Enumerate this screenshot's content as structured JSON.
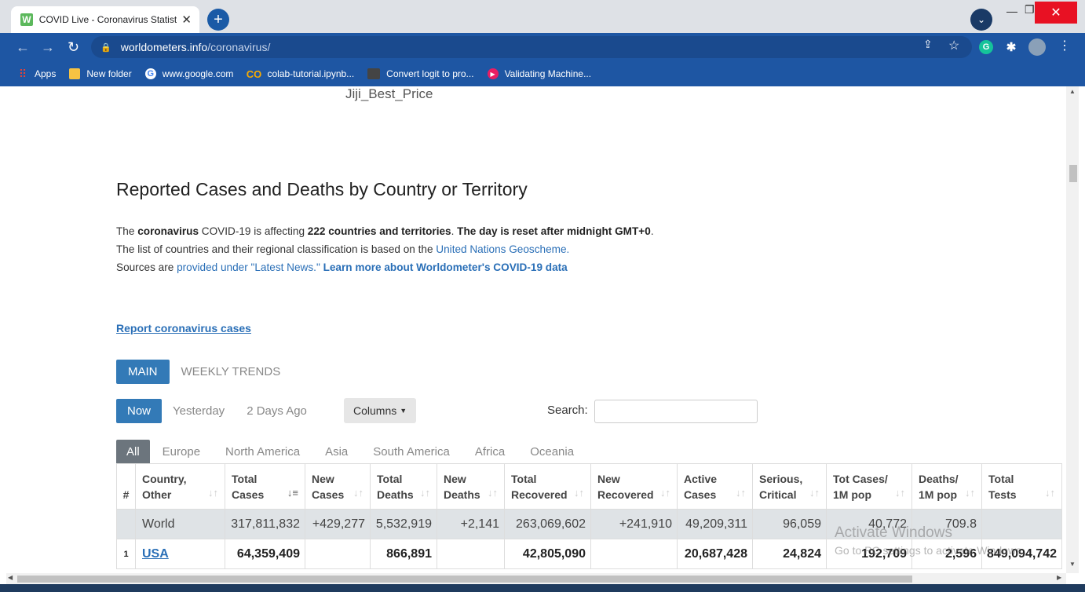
{
  "browser": {
    "tab_title": "COVID Live - Coronavirus Statisti",
    "favicon_letter": "W",
    "url_host": "worldometers.info",
    "url_path": "/coronavirus/",
    "bookmarks": [
      {
        "label": "Apps",
        "icon": "apps-grid-icon"
      },
      {
        "label": "New folder",
        "icon": "folder-icon"
      },
      {
        "label": "www.google.com",
        "icon": "google-icon"
      },
      {
        "label": "colab-tutorial.ipynb...",
        "icon": "colab-icon"
      },
      {
        "label": "Convert logit to pro...",
        "icon": "page-thumbnail-icon"
      },
      {
        "label": "Validating Machine...",
        "icon": "play-icon"
      }
    ]
  },
  "page": {
    "ad_label": "Jiji_Best_Price",
    "heading": "Reported Cases and Deaths by Country or Territory",
    "intro": {
      "p1": "The ",
      "b1": "coronavirus",
      "p2": " COVID-19 is affecting ",
      "b2": "222 countries and territories",
      "p3": ". ",
      "b3": "The day is reset after midnight GMT+0",
      "p4": ". The list of countries and their regional classification is based on the ",
      "link1": "United Nations Geoscheme.",
      "p5": " Sources are ",
      "link2": "provided under \"Latest News.\"",
      "p6": " ",
      "link3": "Learn more about Worldometer's COVID-19 data"
    },
    "report_link": "Report coronavirus cases",
    "view_tabs": [
      "MAIN",
      "WEEKLY TRENDS"
    ],
    "day_tabs": [
      "Now",
      "Yesterday",
      "2 Days Ago"
    ],
    "columns_button": "Columns",
    "search_label": "Search:",
    "search_value": "",
    "regions": [
      "All",
      "Europe",
      "North America",
      "Asia",
      "South America",
      "Africa",
      "Oceania"
    ]
  },
  "table": {
    "headers": [
      "#",
      "Country, Other",
      "Total Cases",
      "New Cases",
      "Total Deaths",
      "New Deaths",
      "Total Recovered",
      "New Recovered",
      "Active Cases",
      "Serious, Critical",
      "Tot Cases/ 1M pop",
      "Deaths/ 1M pop",
      "Total Tests"
    ],
    "header_lines": [
      [
        "#",
        ""
      ],
      [
        "Country,",
        "Other"
      ],
      [
        "Total",
        "Cases"
      ],
      [
        "New",
        "Cases"
      ],
      [
        "Total",
        "Deaths"
      ],
      [
        "New",
        "Deaths"
      ],
      [
        "Total",
        "Recovered"
      ],
      [
        "New",
        "Recovered"
      ],
      [
        "Active",
        "Cases"
      ],
      [
        "Serious,",
        "Critical"
      ],
      [
        "Tot Cases/",
        "1M pop"
      ],
      [
        "Deaths/",
        "1M pop"
      ],
      [
        "Total",
        "Tests"
      ]
    ],
    "world": [
      "",
      "World",
      "317,811,832",
      "+429,277",
      "5,532,919",
      "+2,141",
      "263,069,602",
      "+241,910",
      "49,209,311",
      "96,059",
      "40,772",
      "709.8",
      ""
    ],
    "rows": [
      [
        "1",
        "USA",
        "64,359,409",
        "",
        "866,891",
        "",
        "42,805,090",
        "",
        "20,687,428",
        "24,824",
        "192,709",
        "2,596",
        "849,094,742"
      ]
    ]
  },
  "watermark": {
    "line1": "Activate Windows",
    "line2": "Go to PC settings to activate Windows."
  },
  "colors": {
    "chrome_blue": "#1e56a3",
    "accent": "#337ab7",
    "link": "#2a6fb7"
  }
}
